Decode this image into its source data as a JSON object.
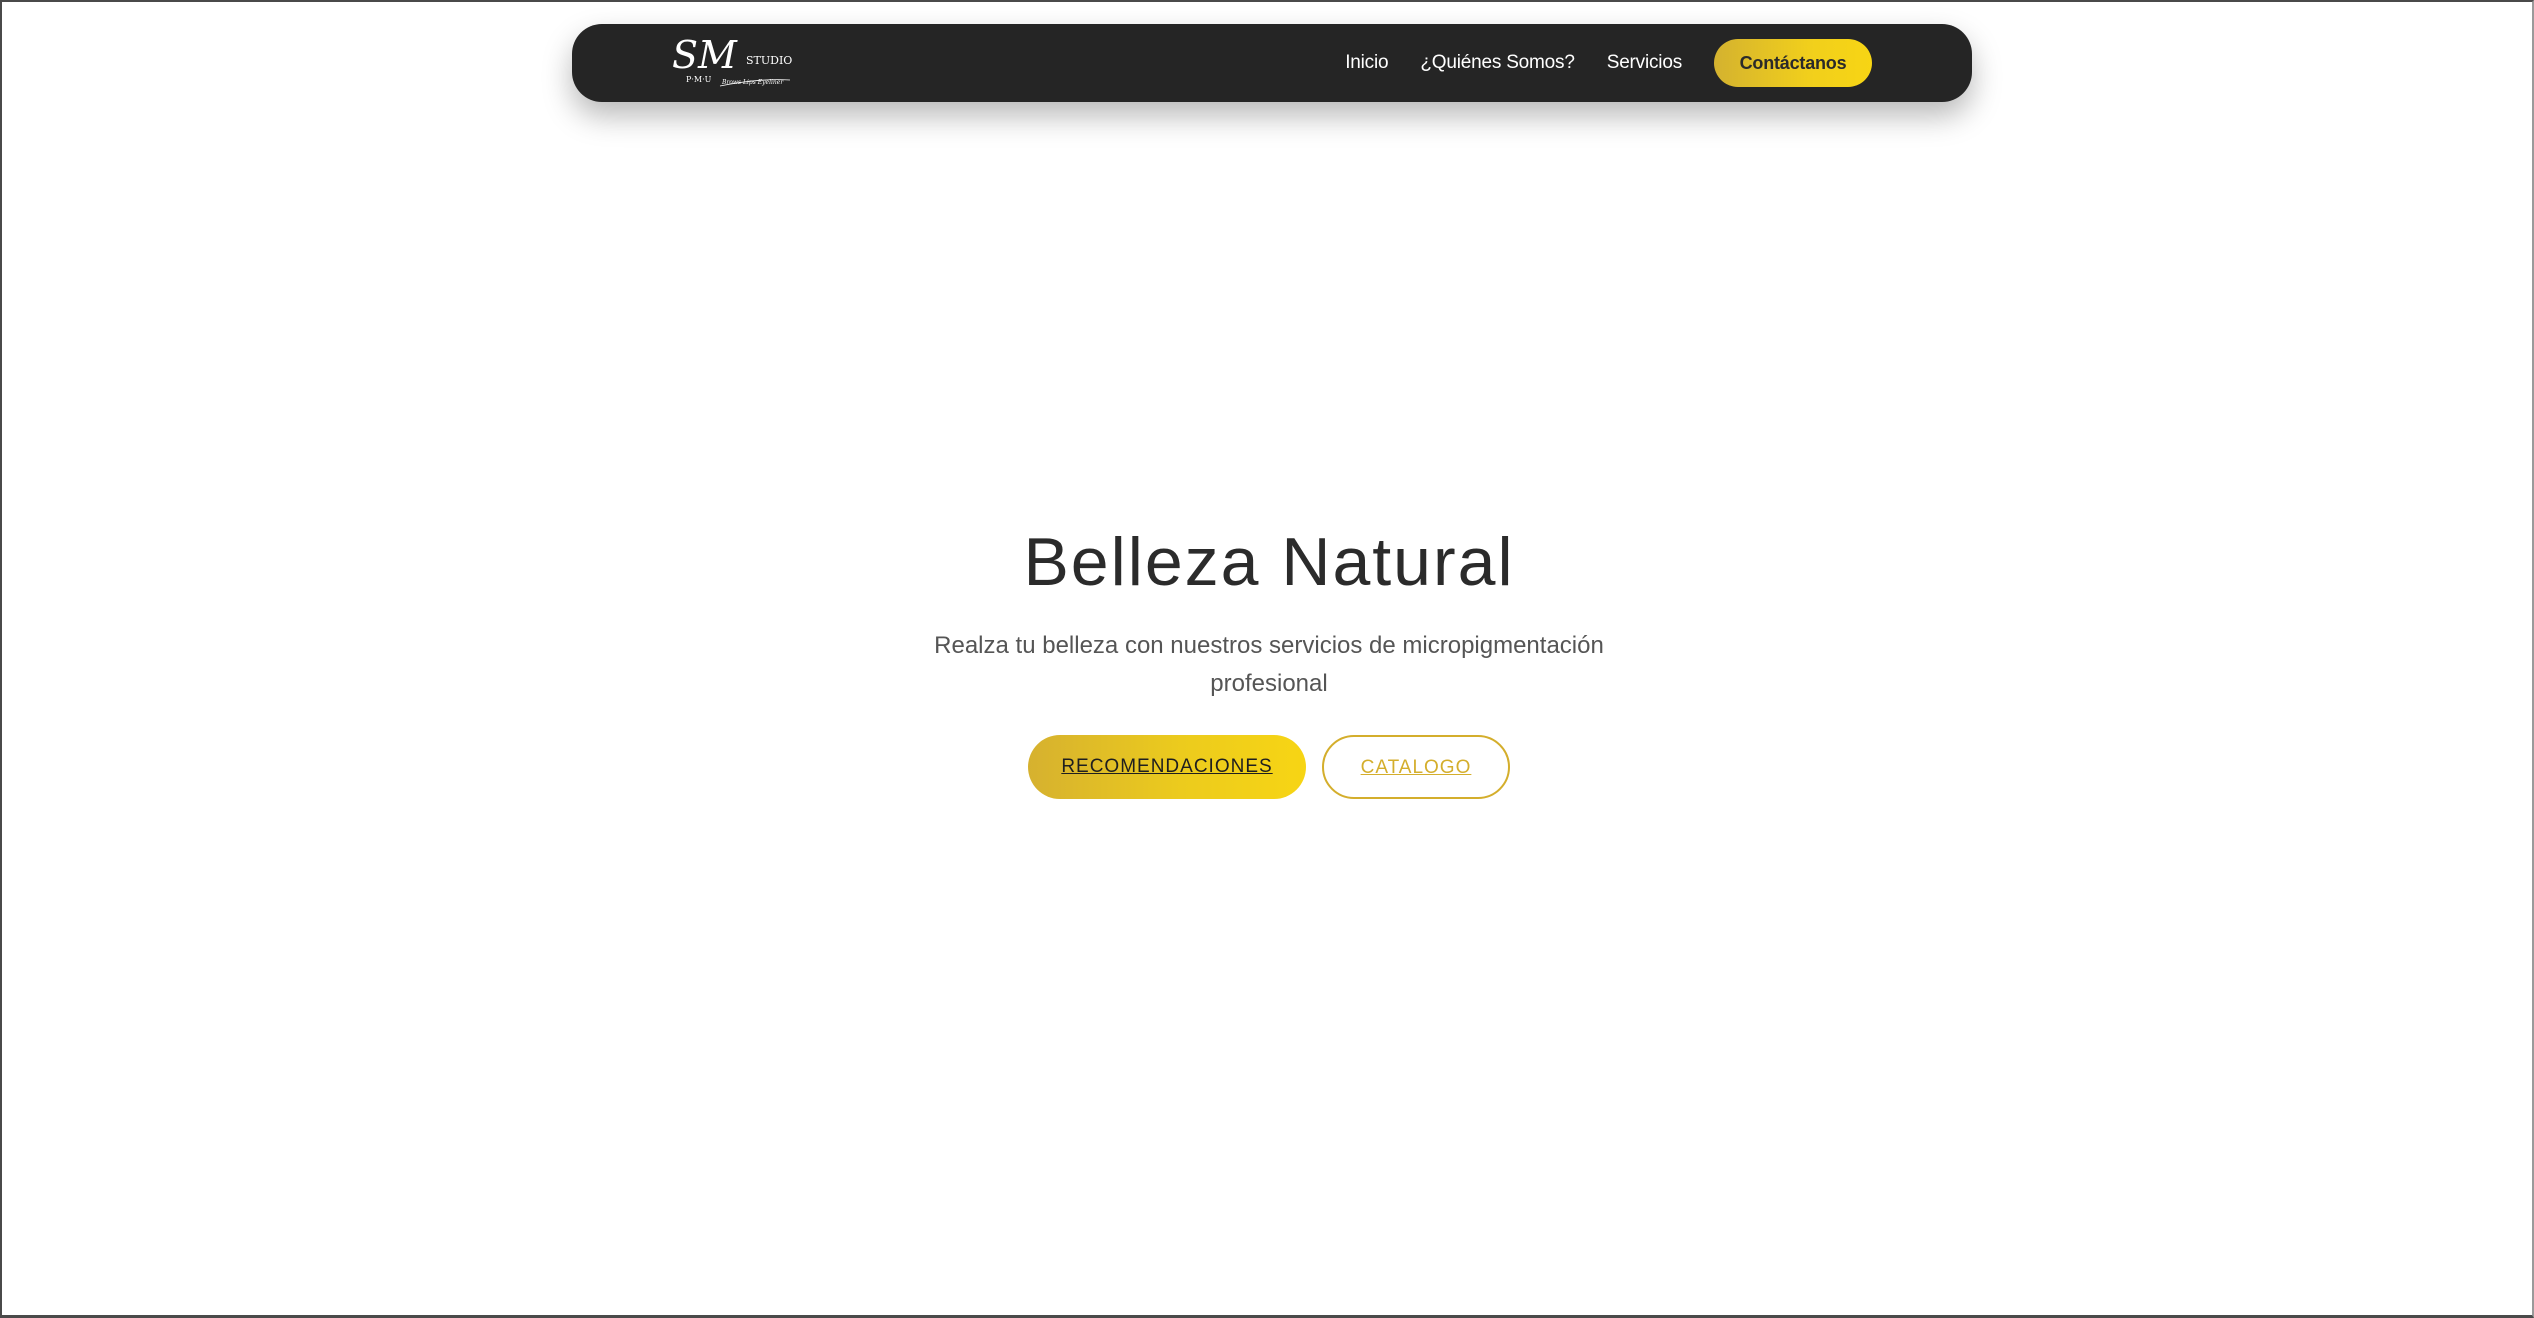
{
  "navbar": {
    "logo": {
      "icon": "sm-studio-logo",
      "monogram": "SM",
      "wordmark": "STUDIO",
      "tagline": "P·M·U",
      "script_line": "Brows Lips Eyeliner"
    },
    "links": [
      {
        "label": "Inicio"
      },
      {
        "label": "¿Quiénes Somos?"
      },
      {
        "label": "Servicios"
      }
    ],
    "cta_label": "Contáctanos"
  },
  "hero": {
    "title": "Belleza Natural",
    "subtitle": "Realza tu belleza con nuestros servicios de micropigmentación profesional",
    "primary_button": "RECOMENDACIONES",
    "secondary_button": "CATALOGO"
  },
  "colors": {
    "navbar_bg": "#252525",
    "accent_gold": "#d4ae2c",
    "accent_yellow": "#f7d514",
    "title_text": "#2b2b2b",
    "subtitle_text": "#555555"
  }
}
